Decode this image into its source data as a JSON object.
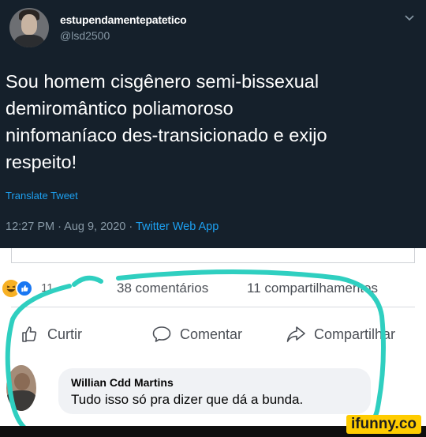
{
  "tweet": {
    "display_name": "estupendamentepatetico",
    "handle": "@lsd2500",
    "text_lines": [
      "Sou homem cisgênero semi-bissexual",
      "demiromântico poliamoroso",
      "ninfomaníaco des-transicionado e exijo",
      "respeito!"
    ],
    "translate_label": "Translate Tweet",
    "timestamp": "12:27 PM · Aug 9, 2020 · ",
    "source_app": "Twitter Web App"
  },
  "facebook": {
    "reaction_count": "11",
    "comments_count": "38 comentários",
    "shares_count": "11 compartilhamentos",
    "actions": {
      "like": "Curtir",
      "comment": "Comentar",
      "share": "Compartilhar"
    },
    "comment": {
      "author": "Willian Cdd Martins",
      "text": "Tudo isso só pra dizer que dá a bunda."
    }
  },
  "watermark": "ifunny.co",
  "colors": {
    "tweet_bg": "#15202b",
    "link_blue": "#1da1f2",
    "fb_like_blue": "#1877f2",
    "scribble": "#2fcfc0",
    "watermark_bg": "#ffcc00"
  },
  "icons": [
    "chevron-down-icon",
    "haha-reaction-icon",
    "like-reaction-icon",
    "thumbs-up-icon",
    "speech-bubble-icon",
    "share-arrow-icon"
  ]
}
